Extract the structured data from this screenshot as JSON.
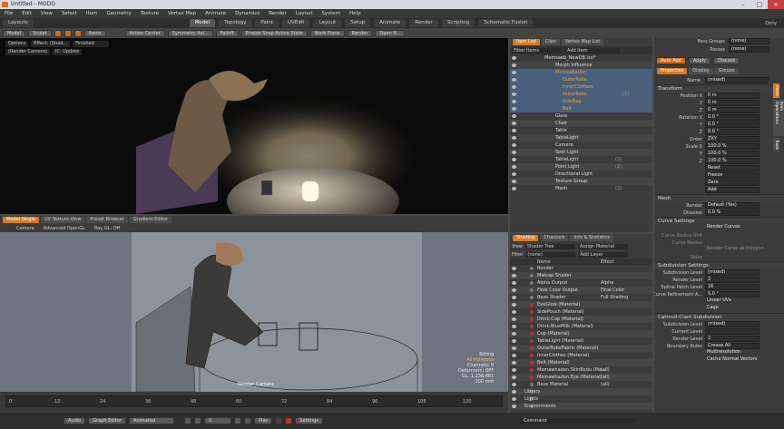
{
  "window": {
    "title": "Untitled - MODO"
  },
  "menu": [
    "File",
    "Edit",
    "View",
    "Select",
    "Item",
    "Geometry",
    "Texture",
    "Vertex Map",
    "Animate",
    "Dynamics",
    "Render",
    "Layout",
    "System",
    "Help"
  ],
  "layouts_label": "Layouts",
  "top_tabs": [
    "Model",
    "Topology",
    "Paint",
    "UVEdit",
    "Layout",
    "Setup",
    "Animate",
    "Render",
    "Scripting",
    "Schematic Fusion"
  ],
  "only_label": "Only",
  "toolbar": {
    "model": "Model",
    "sculpt": "Sculpt",
    "items": "Items",
    "action_center": "Action Center",
    "symmetry": "Symmetry Axi...",
    "falloff": "Falloff",
    "snap": "Enable Snap Active State",
    "work_plane": "Work Plane",
    "render": "Render",
    "open_r": "Open R..."
  },
  "viewport_top": {
    "options": "Options",
    "effect": "Effect: (Shad...",
    "finished": "Finished",
    "camera": "(Render Camera)",
    "ic": "IC: Update"
  },
  "viewport_tabs": [
    "Model Single",
    "UV Texture View",
    "Preset Browser",
    "Gradient Editor"
  ],
  "viewport_bottom": {
    "camera": "Camera",
    "opengl": "Advanced OpenGL",
    "raygl": "Ray GL: Off",
    "status": [
      "Sitting",
      "All Polygons",
      "Channels: 0",
      "Deformers: OFF",
      "GL: 1,236,461",
      "200 mm"
    ],
    "render_camera": "Render_Camera"
  },
  "itemlist": {
    "tabs": [
      "Item List",
      "Clips",
      "Vertex Map List"
    ],
    "filter": "Filter Items",
    "add": "Add Item",
    "items": [
      {
        "label": "Momsaeb_NewOB.lxo*",
        "count": ""
      },
      {
        "label": "Morph Influence",
        "count": ""
      },
      {
        "label": "MomsaNadon",
        "count": ""
      },
      {
        "label": "OuterRobe",
        "count": ""
      },
      {
        "label": "InnerClothers",
        "count": ""
      },
      {
        "label": "OuterRobe",
        "count": "(2)"
      },
      {
        "label": "SideBag",
        "count": ""
      },
      {
        "label": "Belt",
        "count": ""
      },
      {
        "label": "Glass",
        "count": ""
      },
      {
        "label": "Chair",
        "count": ""
      },
      {
        "label": "Table",
        "count": ""
      },
      {
        "label": "TableLight",
        "count": ""
      },
      {
        "label": "Camera",
        "count": ""
      },
      {
        "label": "Spot Light",
        "count": ""
      },
      {
        "label": "TableLight",
        "count": "(2)"
      },
      {
        "label": "Point Light",
        "count": "(2)"
      },
      {
        "label": "Directional Light",
        "count": ""
      },
      {
        "label": "Texture Group",
        "count": ""
      },
      {
        "label": "Mesh",
        "count": "(2)"
      }
    ]
  },
  "shading": {
    "tabs": [
      "Shading",
      "Channels",
      "Info & Statistics"
    ],
    "view_label": "View",
    "view_value": "Shader Tree",
    "assign": "Assign Material",
    "filter_label": "Filter",
    "filter_value": "(none)",
    "add": "Add Layer",
    "col_name": "Name",
    "col_effect": "Effect",
    "items": [
      {
        "label": "Render",
        "effect": ""
      },
      {
        "label": "Matcap Shader",
        "effect": ""
      },
      {
        "label": "Alpha Output",
        "effect": "Alpha"
      },
      {
        "label": "Final Color Output",
        "effect": "Final Color"
      },
      {
        "label": "Base Shader",
        "effect": "Full Shading"
      },
      {
        "label": "EyeGlow (Material)",
        "effect": ""
      },
      {
        "label": "SidePouch (Material)",
        "effect": ""
      },
      {
        "label": "Drink-Cup (Material)",
        "effect": ""
      },
      {
        "label": "Drink-BlueMilk (Material)",
        "effect": ""
      },
      {
        "label": "Cup (Material)",
        "effect": ""
      },
      {
        "label": "TableLight (Material)",
        "effect": ""
      },
      {
        "label": "OuterRobeFabric (Material)",
        "effect": ""
      },
      {
        "label": "InnerClothes (Material)",
        "effect": ""
      },
      {
        "label": "Belt (Material)",
        "effect": ""
      },
      {
        "label": "Momawhadon.SkinBodu (Ma...",
        "effect": "(all)"
      },
      {
        "label": "Momawhadon.Eye (Material)",
        "effect": "(all)"
      },
      {
        "label": "Base Material",
        "effect": "(all)"
      },
      {
        "label": "Library",
        "effect": ""
      },
      {
        "label": "Lights",
        "effect": ""
      },
      {
        "label": "Environments",
        "effect": ""
      },
      {
        "label": "FX",
        "effect": ""
      }
    ]
  },
  "props": {
    "pass_groups": "Pass Groups",
    "passes": "Passes",
    "none": "(none)",
    "auto_add": "Auto Add",
    "apply": "Apply",
    "discard": "Discard",
    "tabs": [
      "Properties",
      "Display",
      "Groups"
    ],
    "name_label": "Name",
    "name_value": "(mixed)",
    "transform": "Transform",
    "rows": [
      {
        "label": "Position X",
        "value": "0 m"
      },
      {
        "label": "Y",
        "value": "0 m"
      },
      {
        "label": "Z",
        "value": "0 m"
      },
      {
        "label": "Rotation X",
        "value": "0.0 °"
      },
      {
        "label": "Y",
        "value": "0.0 °"
      },
      {
        "label": "Z",
        "value": "0.0 °"
      },
      {
        "label": "Order",
        "value": "ZXY"
      },
      {
        "label": "Scale X",
        "value": "100.0 %"
      },
      {
        "label": "Y",
        "value": "100.0 %"
      },
      {
        "label": "Z",
        "value": "100.0 %"
      }
    ],
    "buttons": [
      "Reset",
      "Freeze",
      "Zero",
      "Add"
    ],
    "mesh": "Mesh",
    "render_label": "Render",
    "render_value": "Default (Yes)",
    "dissolve_label": "Dissolve",
    "dissolve_value": "0.0 %",
    "curve_settings": "Curve Settings",
    "render_curves": "Render Curves",
    "curve_radius_unit": "Curve Radius Unit",
    "curve_radius": "Curve Radius",
    "render_curve_poly": "Render Curve as Polygon",
    "sides": "Sides",
    "subdivision_settings": "Subdivision Settings",
    "sub_rows": [
      {
        "label": "Subdivision Level",
        "value": "(mixed)"
      },
      {
        "label": "Render Level",
        "value": "2"
      },
      {
        "label": "Spline Patch Level",
        "value": "16"
      },
      {
        "label": "Curve Refinement A...",
        "value": "5.0 °"
      }
    ],
    "linear_uvs": "Linear UVs",
    "cage": "Cage",
    "catmull": "Catmull-Clark Subdivision",
    "cc_rows": [
      {
        "label": "Subdivision Level",
        "value": "(mixed)"
      },
      {
        "label": "Current Level",
        "value": ""
      },
      {
        "label": "Render Level",
        "value": "2"
      },
      {
        "label": "Boundary Rules",
        "value": "Crease All"
      }
    ],
    "multiresolution": "Multiresolution",
    "cache_normal": "Cache Normal Vectors",
    "side_tabs": [
      "Mesh",
      "Item Operations",
      "Tools"
    ]
  },
  "timeline": {
    "ticks": [
      "0",
      "12",
      "24",
      "36",
      "48",
      "60",
      "72",
      "84",
      "96",
      "108",
      "120"
    ],
    "frame_value": "0"
  },
  "bottom": {
    "audio": "Audio",
    "graph_editor": "Graph Editor",
    "animated": "Animated",
    "play": "Play",
    "settings": "Settings",
    "command": "Command"
  },
  "colors": {
    "accent": "#d77a1e",
    "selection": "#4a5f7a"
  }
}
